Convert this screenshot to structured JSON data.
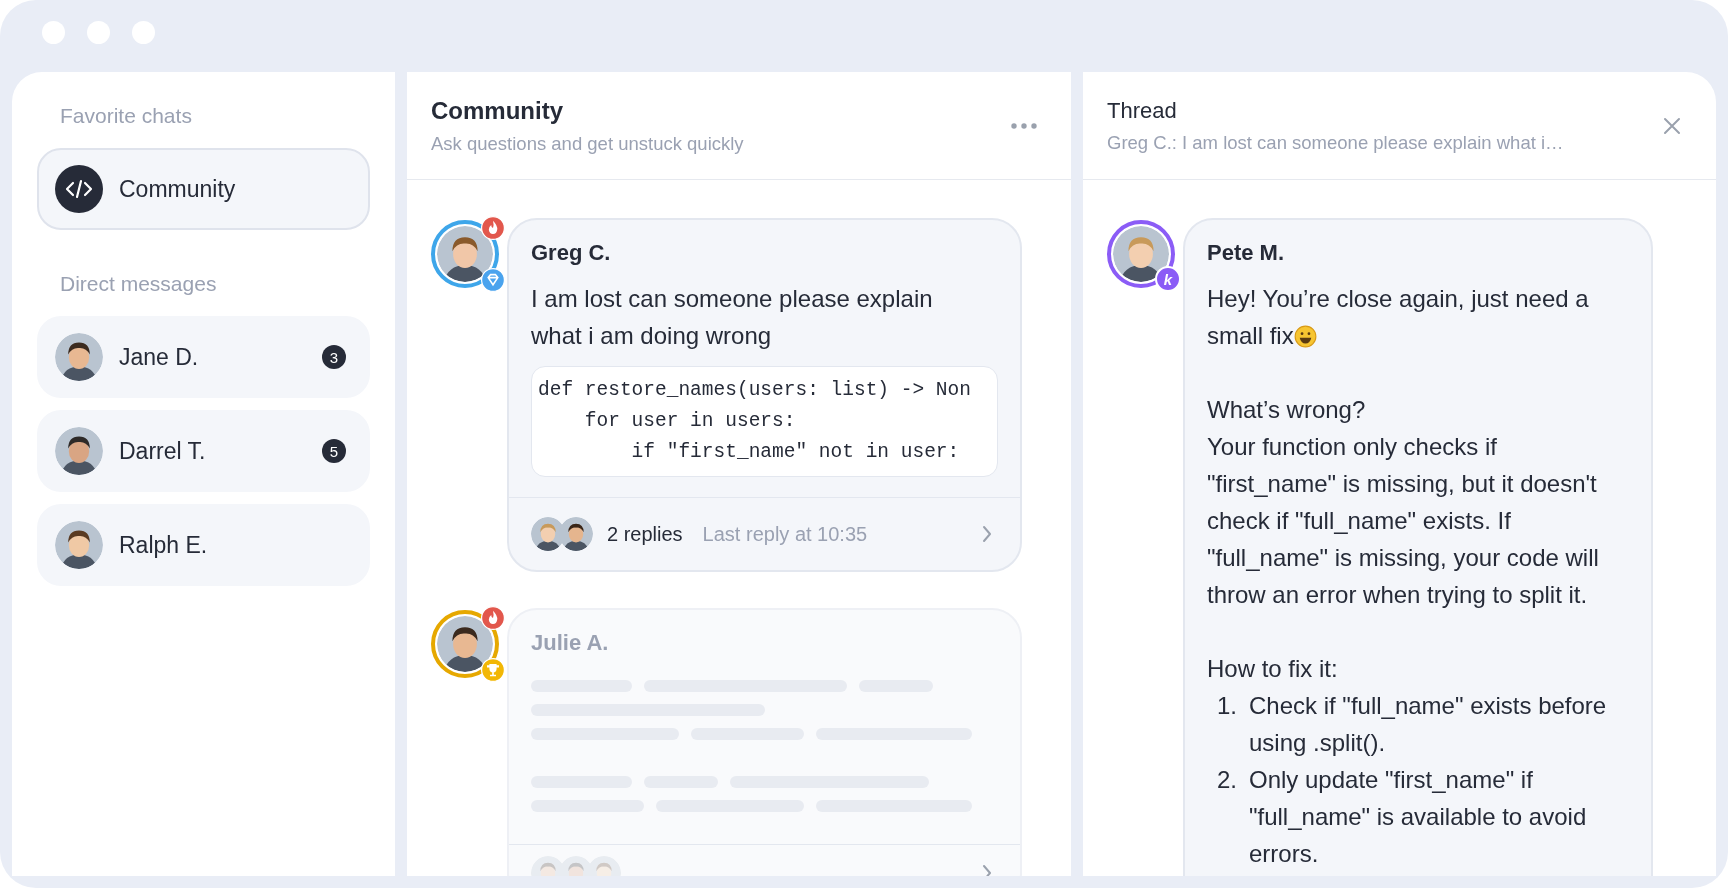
{
  "sidebar": {
    "sections": [
      {
        "title": "Favorite chats",
        "items": [
          {
            "kind": "channel",
            "label": "Community",
            "selected": true
          }
        ]
      },
      {
        "title": "Direct messages",
        "items": [
          {
            "kind": "person",
            "label": "Jane D.",
            "selected": false,
            "unread": "3"
          },
          {
            "kind": "person",
            "label": "Darrel T.",
            "selected": false,
            "unread": "5"
          },
          {
            "kind": "person",
            "label": "Ralph E.",
            "selected": false
          }
        ]
      }
    ]
  },
  "channel": {
    "title": "Community",
    "subtitle": "Ask questions and get unstuck quickly",
    "messages": [
      {
        "author": "Greg C.",
        "color": "#3ea6ea",
        "badges": [
          {
            "kind": "fire"
          },
          {
            "kind": "diamond"
          }
        ],
        "loading": false,
        "text": "I am lost can someone please explain what i am doing wrong",
        "code": [
          "def restore_names(users: list) -> Non",
          "    for user in users:",
          "        if \"first_name\" not in user:"
        ],
        "replies": {
          "count": "2 replies",
          "last": "Last reply at 10:35"
        }
      },
      {
        "author": "Julie A.",
        "color": "#e6a800",
        "badges": [
          {
            "kind": "fire"
          },
          {
            "kind": "trophy"
          }
        ],
        "loading": true
      }
    ]
  },
  "thread": {
    "title": "Thread",
    "subtitle": "Greg C.: I am lost can someone please explain what i…",
    "message": {
      "author": "Pete M.",
      "color": "#8b5cf6",
      "badges": [
        {
          "kind": "letter",
          "text": "k"
        }
      ],
      "blocks": [
        {
          "kind": "paragraph",
          "lines": [
            "Hey! You’re close again, just need a small fix"
          ],
          "emoji": true
        },
        {
          "kind": "paragraph",
          "lines": [
            "What’s wrong?",
            "Your function only checks if \"first_name\" is missing, but it doesn't check if \"full_name\" exists. If \"full_name\" is missing, your code will throw an error when trying to split it."
          ]
        },
        {
          "kind": "list",
          "title": "How to fix it:",
          "items": [
            {
              "number": "1.",
              "text": "Check if \"full_name\" exists before using .split()."
            },
            {
              "number": "2.",
              "text": "Only update \"first_name\" if \"full_name\" is available to avoid errors."
            }
          ]
        }
      ]
    }
  }
}
